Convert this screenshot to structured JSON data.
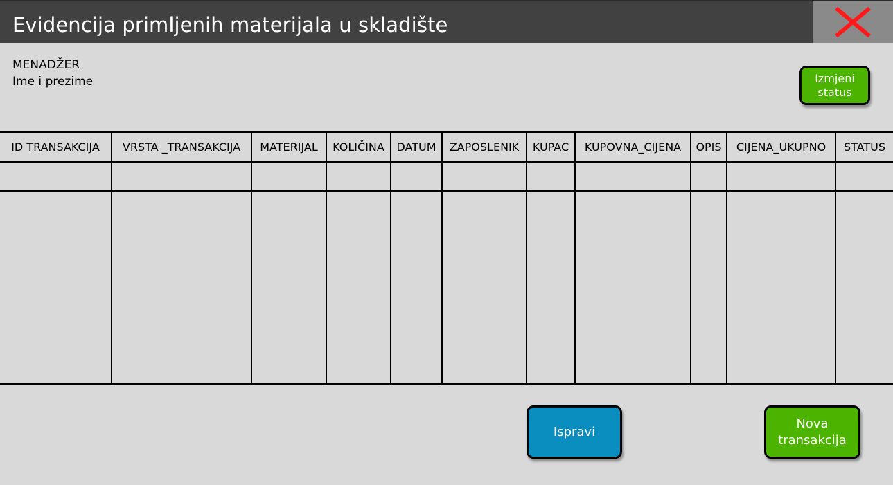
{
  "window": {
    "title": "Evidencija primljenih materijala u skladište",
    "close_icon": "close-x-icon",
    "close_icon_color": "#ff1a1a",
    "titlebar_color": "#414141"
  },
  "user": {
    "role": "MENADŽER",
    "name": "Ime i prezime"
  },
  "buttons": {
    "change_status": "Izmjeni\nstatus",
    "correct": "Ispravi",
    "new_transaction": "Nova\ntransakcija"
  },
  "colors": {
    "green": "#4cb300",
    "blue": "#0a8dbf",
    "background": "#d9d9d9"
  },
  "table": {
    "columns": [
      "ID TRANSAKCIJA",
      "VRSTA _TRANSAKCIJA",
      "MATERIJAL",
      "KOLIČINA",
      "DATUM",
      "ZAPOSLENIK",
      "KUPAC",
      "KUPOVNA_CIJENA",
      "OPIS",
      "CIJENA_UKUPNO",
      "STATUS"
    ],
    "rows": [
      [
        "",
        "",
        "",
        "",
        "",
        "",
        "",
        "",
        "",
        "",
        ""
      ],
      [
        "",
        "",
        "",
        "",
        "",
        "",
        "",
        "",
        "",
        "",
        ""
      ]
    ]
  }
}
